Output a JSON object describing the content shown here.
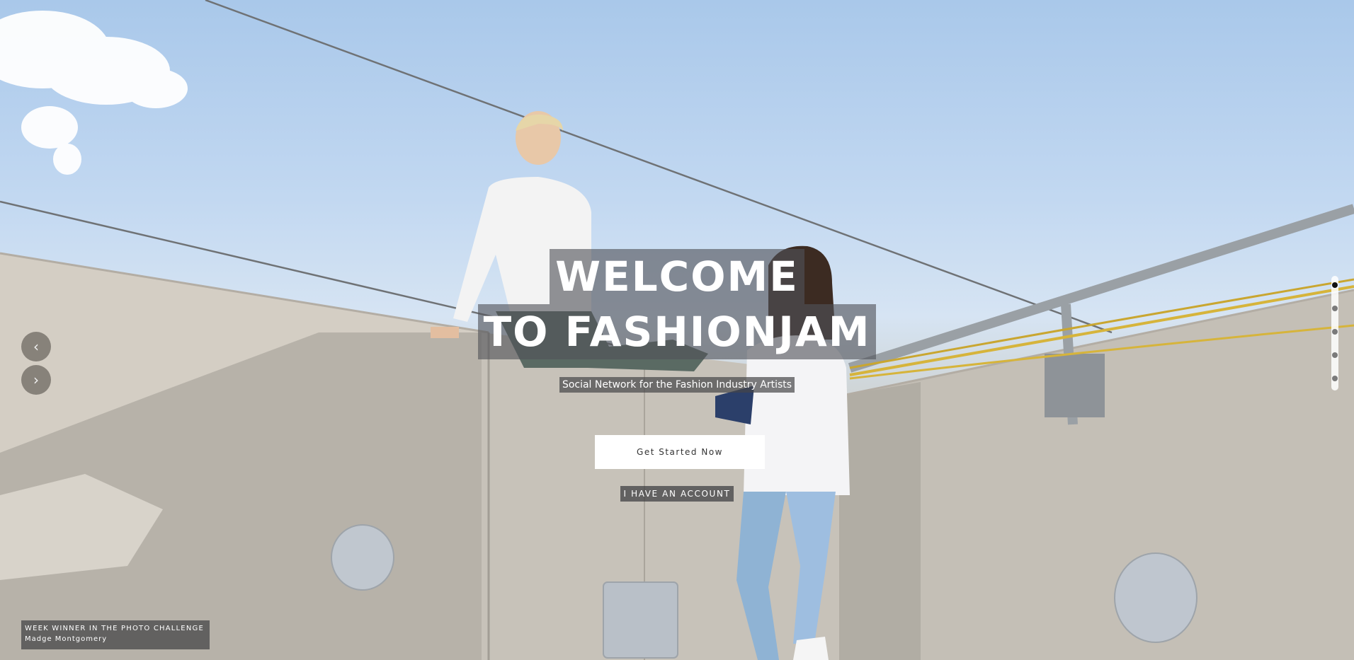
{
  "hero": {
    "title_line1": "WELCOME",
    "title_line2": "TO FASHIONJAM",
    "subtitle": "Social Network for the Fashion Industry Artists",
    "cta_label": "Get Started Now",
    "account_link": "I HAVE AN ACCOUNT"
  },
  "carousel": {
    "prev_icon": "chevron-left-icon",
    "next_icon": "chevron-right-icon",
    "prev_glyph": "‹",
    "next_glyph": "›",
    "slide_count": 5,
    "active_slide": 1
  },
  "winner": {
    "label": "WEEK WINNER IN THE PHOTO CHALLENGE",
    "name": "Madge Montgomery"
  },
  "colors": {
    "sky": "#a9c8ea",
    "wall": "#c9c3b9",
    "overlay": "#505258",
    "button_bg": "#ffffff"
  }
}
